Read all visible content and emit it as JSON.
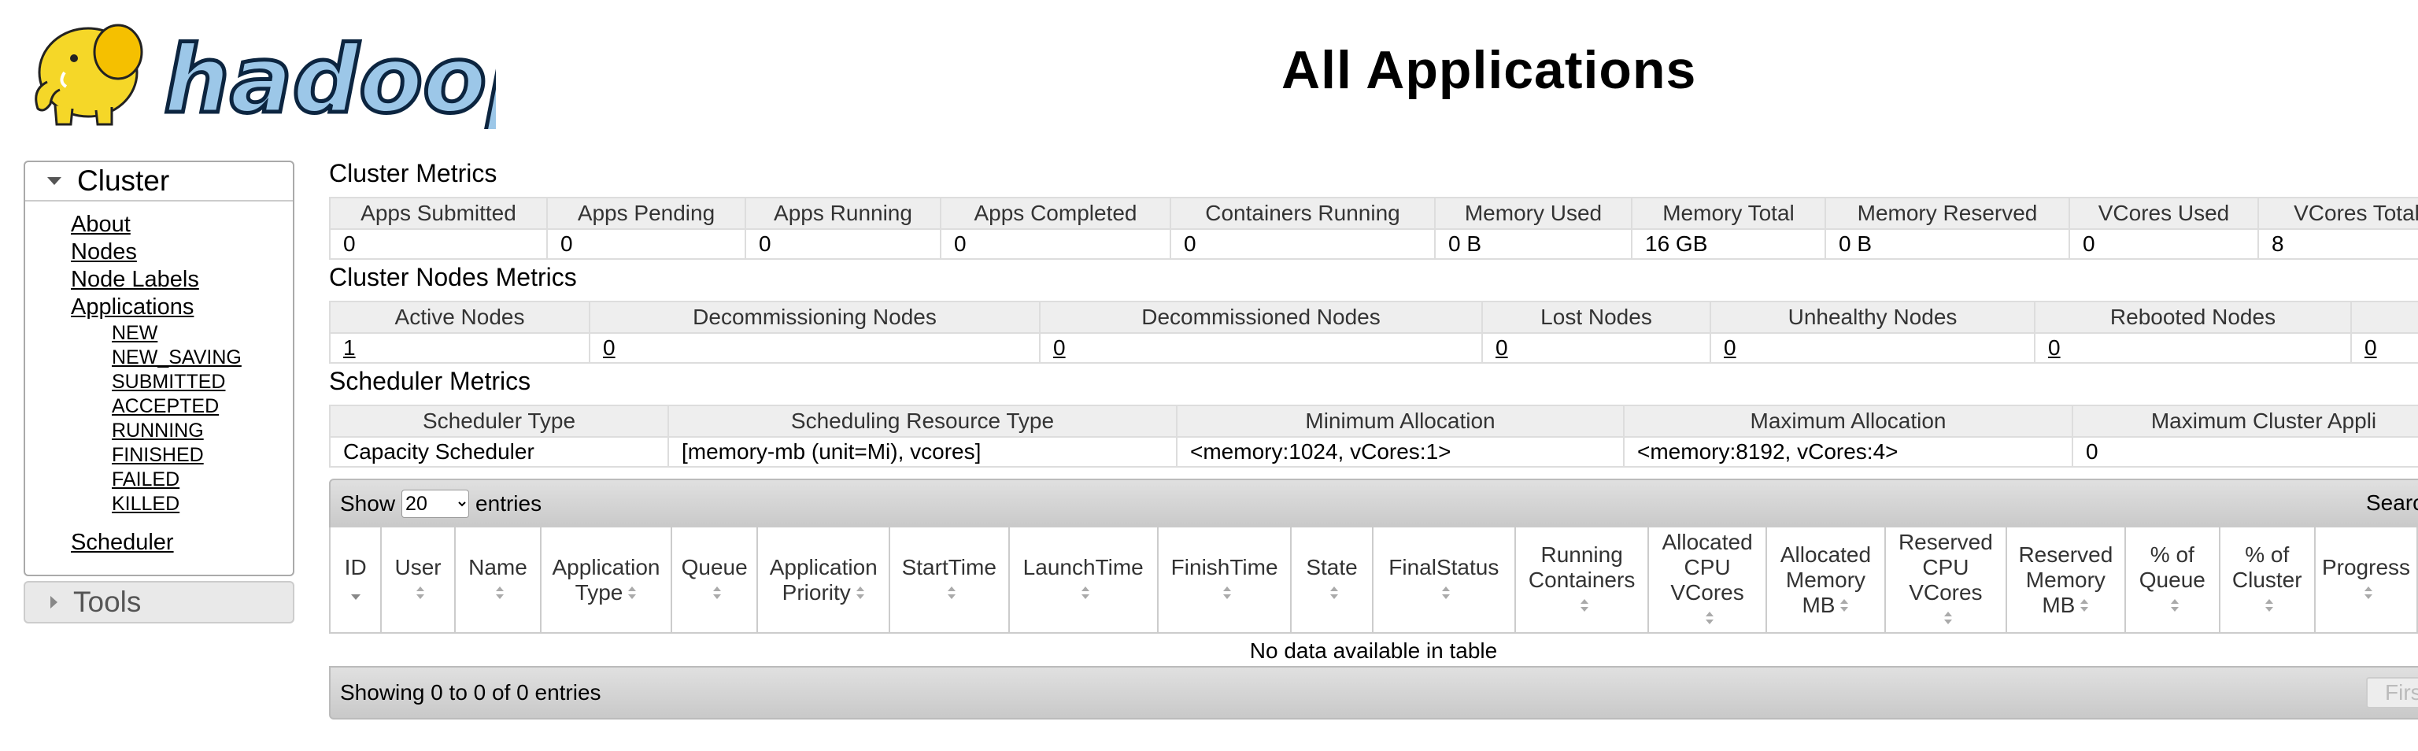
{
  "page": {
    "title": "All Applications"
  },
  "logo": {
    "text": "hadoop"
  },
  "sidebar": {
    "cluster_label": "Cluster",
    "links": [
      {
        "label": "About"
      },
      {
        "label": "Nodes"
      },
      {
        "label": "Node Labels"
      },
      {
        "label": "Applications"
      }
    ],
    "app_states": [
      {
        "label": "NEW"
      },
      {
        "label": "NEW_SAVING"
      },
      {
        "label": "SUBMITTED"
      },
      {
        "label": "ACCEPTED"
      },
      {
        "label": "RUNNING"
      },
      {
        "label": "FINISHED"
      },
      {
        "label": "FAILED"
      },
      {
        "label": "KILLED"
      }
    ],
    "scheduler_label": "Scheduler",
    "tools_label": "Tools"
  },
  "cluster_metrics": {
    "title": "Cluster Metrics",
    "headers": [
      "Apps Submitted",
      "Apps Pending",
      "Apps Running",
      "Apps Completed",
      "Containers Running",
      "Memory Used",
      "Memory Total",
      "Memory Reserved",
      "VCores Used",
      "VCores Total"
    ],
    "values": [
      "0",
      "0",
      "0",
      "0",
      "0",
      "0 B",
      "16 GB",
      "0 B",
      "0",
      "8"
    ]
  },
  "node_metrics": {
    "title": "Cluster Nodes Metrics",
    "headers": [
      "Active Nodes",
      "Decommissioning Nodes",
      "Decommissioned Nodes",
      "Lost Nodes",
      "Unhealthy Nodes",
      "Rebooted Nodes",
      ""
    ],
    "values": [
      "1",
      "0",
      "0",
      "0",
      "0",
      "0",
      "0"
    ]
  },
  "scheduler_metrics": {
    "title": "Scheduler Metrics",
    "headers": [
      "Scheduler Type",
      "Scheduling Resource Type",
      "Minimum Allocation",
      "Maximum Allocation",
      "Maximum Cluster Appli"
    ],
    "values": [
      "Capacity Scheduler",
      "[memory-mb (unit=Mi), vcores]",
      "<memory:1024, vCores:1>",
      "<memory:8192, vCores:4>",
      "0"
    ]
  },
  "apps_table": {
    "show_label": "Show",
    "entries_label": "entries",
    "page_length": "20",
    "search_label": "Searc",
    "columns": [
      {
        "label": "ID"
      },
      {
        "label": "User"
      },
      {
        "label": "Name"
      },
      {
        "label": "Application Type"
      },
      {
        "label": "Queue"
      },
      {
        "label": "Application Priority"
      },
      {
        "label": "StartTime"
      },
      {
        "label": "LaunchTime"
      },
      {
        "label": "FinishTime"
      },
      {
        "label": "State"
      },
      {
        "label": "FinalStatus"
      },
      {
        "label": "Running Containers"
      },
      {
        "label": "Allocated CPU VCores"
      },
      {
        "label": "Allocated Memory MB"
      },
      {
        "label": "Reserved CPU VCores"
      },
      {
        "label": "Reserved Memory MB"
      },
      {
        "label": "% of Queue"
      },
      {
        "label": "% of Cluster"
      },
      {
        "label": "Progress"
      }
    ],
    "empty_message": "No data available in table",
    "info": "Showing 0 to 0 of 0 entries",
    "first_label": "First"
  },
  "colors": {
    "header_bg": "#eeeeee",
    "border": "#dddddd",
    "bar_bg": "#d4d4d4",
    "logo_yellow": "#f5d728",
    "logo_blue": "#1e6fa8"
  }
}
